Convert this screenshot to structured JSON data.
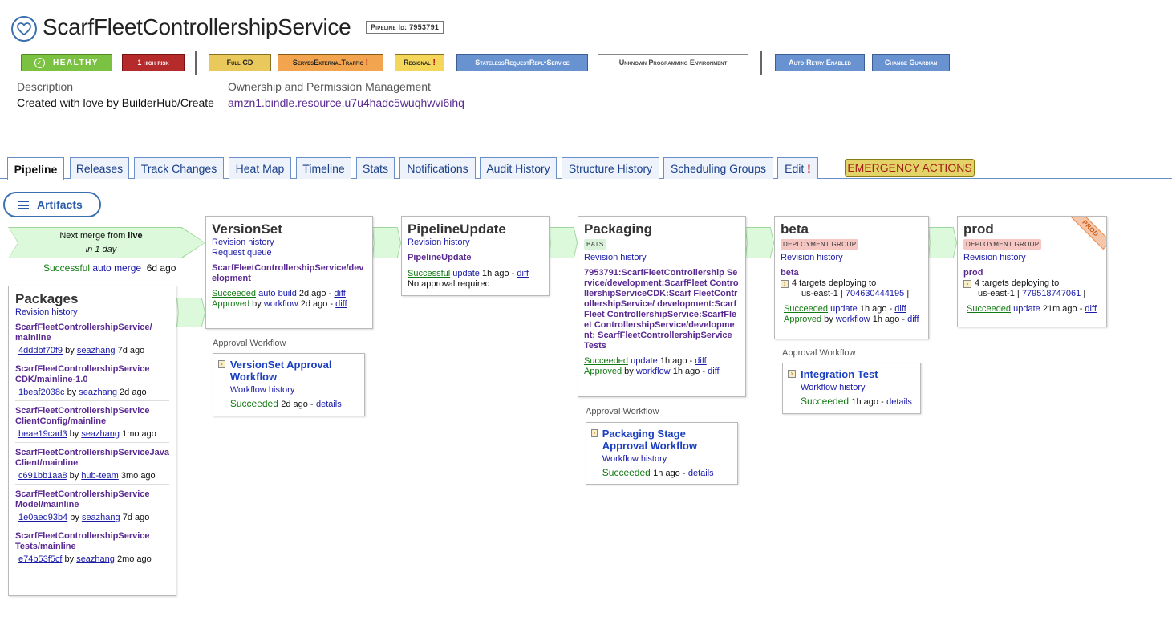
{
  "header": {
    "title": "ScarfFleetControllershipService",
    "pipeline_id": "Pipeline Id: 7953791",
    "icon": "heart-icon"
  },
  "badges": {
    "healthy": "HEALTHY",
    "high_risk": "1 high risk",
    "full_cd": "Full CD",
    "serves_external": "ServesExternalTraffic",
    "regional": "Regional",
    "stateless": "StatelessRequestReplyService",
    "unknown_env": "Unknown Programming Environment",
    "auto_retry": "Auto-Retry Enabled",
    "change_guardian": "Change Guardian",
    "exclaim": "!"
  },
  "meta": {
    "description_label": "Description",
    "description_value": "Created with love by BuilderHub/Create",
    "ownership_label": "Ownership and Permission Management",
    "ownership_value": "amzn1.bindle.resource.u7u4hadc5wuqhwvi6ihq"
  },
  "tabs": [
    "Pipeline",
    "Releases",
    "Track Changes",
    "Heat Map",
    "Timeline",
    "Stats",
    "Notifications",
    "Audit History",
    "Structure History",
    "Scheduling Groups",
    "Edit"
  ],
  "edit_exclaim": "!",
  "emergency": "EMERGENCY ACTIONS",
  "artifacts": "Artifacts",
  "merge": {
    "text_prefix": "Next merge from ",
    "branch": "live",
    "when": "in 1 day",
    "status": "Successful",
    "action": "auto merge",
    "ago": "6d ago"
  },
  "packages": {
    "title": "Packages",
    "revision_history": "Revision history",
    "items": [
      {
        "name": "ScarfFleetControllershipService/ mainline",
        "commit": "4dddbf70f9",
        "by": "by",
        "user": "seazhang",
        "ago": "7d ago"
      },
      {
        "name": "ScarfFleetControllershipService CDK/mainline-1.0",
        "commit": "1beaf2038c",
        "by": "by",
        "user": "seazhang",
        "ago": "2d ago"
      },
      {
        "name": "ScarfFleetControllershipService ClientConfig/mainline",
        "commit": "beae19cad3",
        "by": "by",
        "user": "seazhang",
        "ago": "1mo ago"
      },
      {
        "name": "ScarfFleetControllershipServiceJava Client/mainline",
        "commit": "c691bb1aa8",
        "by": "by",
        "user": "hub-team",
        "ago": "3mo ago"
      },
      {
        "name": "ScarfFleetControllershipService Model/mainline",
        "commit": "1e0aed93b4",
        "by": "by",
        "user": "seazhang",
        "ago": "7d ago"
      },
      {
        "name": "ScarfFleetControllershipService Tests/mainline",
        "commit": "e74b53f5cf",
        "by": "by",
        "user": "seazhang",
        "ago": "2mo ago"
      }
    ]
  },
  "versionset": {
    "title": "VersionSet",
    "revision_history": "Revision history",
    "request_queue": "Request queue",
    "name": "ScarfFleetControllershipService/development",
    "status1": "Succeeded",
    "action1": "auto build",
    "ago1": "2d ago -",
    "diff": "diff",
    "status2": "Approved",
    "by2": "by",
    "action2": "workflow",
    "ago2": "2d ago -"
  },
  "approval_label": "Approval Workflow",
  "vs_workflow": {
    "name": "VersionSet Approval Workflow",
    "history": "Workflow history",
    "status": "Succeeded",
    "ago": "2d ago -",
    "details": "details"
  },
  "pipelineupdate": {
    "title": "PipelineUpdate",
    "revision_history": "Revision history",
    "name": "PipelineUpdate",
    "status": "Successful",
    "action": "update",
    "ago": "1h ago -",
    "diff": "diff",
    "approval": "No approval required"
  },
  "packaging": {
    "title": "Packaging",
    "tag": "BATS",
    "revision_history": "Revision history",
    "name": "7953791:ScarfFleetControllership Service/development:ScarfFleet ControllershipServiceCDK:Scarf FleetControllershipService/ development:ScarfFleet ControllershipService:ScarfFleet ControllershipService/development: ScarfFleetControllershipService Tests",
    "status1": "Succeeded",
    "action1": "update",
    "ago1": "1h ago -",
    "diff": "diff",
    "status2": "Approved",
    "by2": "by",
    "action2": "workflow",
    "ago2": "1h ago -"
  },
  "pkg_workflow": {
    "name": "Packaging Stage Approval Workflow",
    "history": "Workflow history",
    "status": "Succeeded",
    "ago": "1h ago -",
    "details": "details"
  },
  "beta": {
    "title": "beta",
    "tag": "DEPLOYMENT GROUP",
    "revision_history": "Revision history",
    "group": "beta",
    "targets": "4 targets deploying to",
    "region": "us-east-1",
    "account": "704630444195",
    "status1": "Succeeded",
    "action1": "update",
    "ago1": "1h ago -",
    "diff": "diff",
    "status2": "Approved",
    "by2": "by",
    "action2": "workflow",
    "ago2": "1h ago -"
  },
  "beta_workflow": {
    "name": "Integration Test",
    "history": "Workflow history",
    "status": "Succeeded",
    "ago": "1h ago -",
    "details": "details"
  },
  "prod": {
    "title": "prod",
    "ribbon": "PROD",
    "tag": "DEPLOYMENT GROUP",
    "revision_history": "Revision history",
    "group": "prod",
    "targets": "4 targets deploying to",
    "region": "us-east-1",
    "account": "779518747061",
    "status1": "Succeeded",
    "action1": "update",
    "ago1": "21m ago -",
    "diff": "diff"
  },
  "colors": {
    "accent": "#3a6fb0",
    "success": "#127a12",
    "link": "#1a1aa8",
    "package_name": "#5a2a91",
    "arrow_fill": "#dcfadb"
  }
}
